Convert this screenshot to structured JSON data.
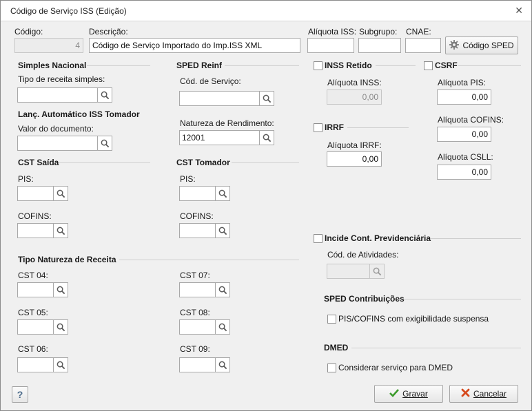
{
  "window": {
    "title": "Código de Serviço ISS (Edição)",
    "close_glyph": "✕"
  },
  "top": {
    "codigo_label": "Código:",
    "codigo_value": "4",
    "descricao_label": "Descrição:",
    "descricao_value": "Código de Serviço Importado do Imp.ISS XML",
    "aliquota_iss_label": "Alíquota ISS:",
    "aliquota_iss_value": "",
    "subgrupo_label": "Subgrupo:",
    "subgrupo_value": "",
    "cnae_label": "CNAE:",
    "cnae_value": "",
    "codigo_sped_button": "Código SPED"
  },
  "simples_nacional": {
    "header": "Simples Nacional",
    "tipo_receita_label": "Tipo de receita simples:",
    "tipo_receita_value": ""
  },
  "lanc_auto": {
    "header": "Lanç. Automático ISS Tomador",
    "valor_label": "Valor do documento:",
    "valor_value": ""
  },
  "sped_reinf": {
    "header": "SPED Reinf",
    "cod_servico_label": "Cód. de Serviço:",
    "cod_servico_value": "",
    "natureza_label": "Natureza de Rendimento:",
    "natureza_value": "12001"
  },
  "cst_saida": {
    "header": "CST Saída",
    "pis_label": "PIS:",
    "cofins_label": "COFINS:"
  },
  "cst_tomador": {
    "header": "CST Tomador",
    "pis_label": "PIS:",
    "cofins_label": "COFINS:"
  },
  "tipo_natureza": {
    "header": "Tipo Natureza de Receita",
    "cst04": "CST 04:",
    "cst05": "CST 05:",
    "cst06": "CST 06:",
    "cst07": "CST 07:",
    "cst08": "CST 08:",
    "cst09": "CST 09:"
  },
  "inss": {
    "label": "INSS Retido",
    "checked": false,
    "aliquota_label": "Alíquota INSS:",
    "aliquota_value": "0,00"
  },
  "irrf": {
    "label": "IRRF",
    "checked": false,
    "aliquota_label": "Alíquota IRRF:",
    "aliquota_value": "0,00"
  },
  "csrf": {
    "label": "CSRF",
    "checked": false,
    "pis_label": "Alíquota PIS:",
    "pis_value": "0,00",
    "cofins_label": "Alíquota COFINS:",
    "cofins_value": "0,00",
    "csll_label": "Alíquota CSLL:",
    "csll_value": "0,00"
  },
  "previdenciaria": {
    "label": "Incide Cont. Previdenciária",
    "checked": false,
    "atividades_label": "Cód. de Atividades:"
  },
  "sped_contrib": {
    "header": "SPED Contribuições",
    "option": "PIS/COFINS com exigibilidade suspensa",
    "checked": false
  },
  "dmed": {
    "header": "DMED",
    "option": "Considerar serviço para DMED",
    "checked": false
  },
  "footer": {
    "help": "?",
    "gravar": "Gravar",
    "cancelar": "Cancelar"
  },
  "colors": {
    "accent_check": "#3a9a2a",
    "cancel_x": "#d64a1e",
    "help": "#4a6a8a"
  }
}
